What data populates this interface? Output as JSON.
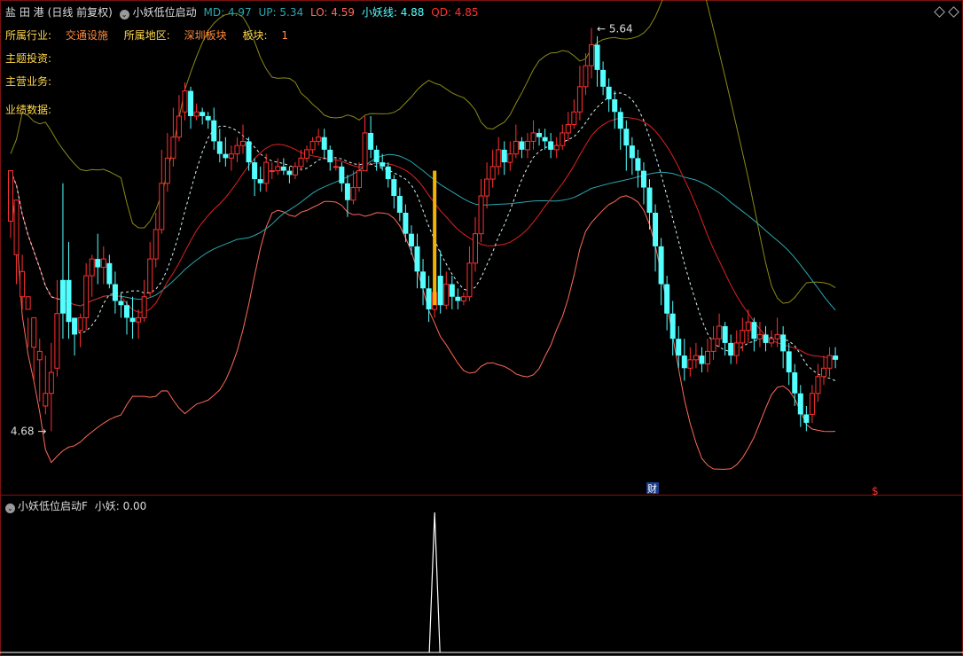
{
  "header": {
    "stock_name": "盐 田 港",
    "period": "(日线 前复权)",
    "indicator": "小妖低位启动",
    "md": "MD: 4.97",
    "up": "UP: 5.34",
    "lo": "LO: 4.59",
    "xy": "小妖线: 4.88",
    "qd": "QD: 4.85"
  },
  "info": {
    "industry_label": "所属行业:",
    "industry_value": "交通设施",
    "region_label": "所属地区:",
    "region_value": "深圳板块",
    "sector_label": "板块:",
    "sector_value": "1",
    "theme_label": "主题投资:",
    "business_label": "主营业务:",
    "performance_label": "业绩数据:"
  },
  "annotations": {
    "high_label": "5.64",
    "low_label": "4.68",
    "finance_marker": "财",
    "dollar_marker": "$"
  },
  "sub": {
    "title": "小妖低位启动F",
    "value": "小妖: 0.00"
  },
  "colors": {
    "up": "#ff3030",
    "down": "#54ffff",
    "md": "#e02020",
    "upper": "#8a8a1a",
    "lower": "#ff6a5a",
    "mid": "#2aa7b0",
    "xy": "#dcf4f4"
  },
  "chart_data": {
    "type": "candlestick",
    "price_range": [
      4.55,
      5.66
    ],
    "candles": [
      [
        5.18,
        5.3,
        5.21,
        5.14
      ],
      [
        5.1,
        5.23,
        5.13,
        5.03
      ],
      [
        5.0,
        5.06,
        5.1,
        4.97
      ],
      [
        4.97,
        5.0,
        4.95,
        4.88
      ],
      [
        4.88,
        4.95,
        4.94,
        4.8
      ],
      [
        4.85,
        4.87,
        4.9,
        4.75
      ],
      [
        4.74,
        4.77,
        4.86,
        4.72
      ],
      [
        4.77,
        4.82,
        4.89,
        4.68
      ],
      [
        4.83,
        4.96,
        5.04,
        4.81
      ],
      [
        5.04,
        4.96,
        5.27,
        4.9
      ],
      [
        5.04,
        4.94,
        5.13,
        4.9
      ],
      [
        4.95,
        4.91,
        4.95,
        4.86
      ],
      [
        4.92,
        4.95,
        4.96,
        4.88
      ],
      [
        4.95,
        5.05,
        5.08,
        4.92
      ],
      [
        5.05,
        5.09,
        5.1,
        5.0
      ],
      [
        5.09,
        5.07,
        5.15,
        5.03
      ],
      [
        5.07,
        5.09,
        5.12,
        5.03
      ],
      [
        5.08,
        5.03,
        5.1,
        5.02
      ],
      [
        5.03,
        4.99,
        5.06,
        4.96
      ],
      [
        4.99,
        4.98,
        5.01,
        4.95
      ],
      [
        4.98,
        4.95,
        4.99,
        4.91
      ],
      [
        4.95,
        4.94,
        5.0,
        4.9
      ],
      [
        4.94,
        4.95,
        4.97,
        4.9
      ],
      [
        4.95,
        5.0,
        5.04,
        4.94
      ],
      [
        5.01,
        5.09,
        5.13,
        5.0
      ],
      [
        5.09,
        5.16,
        5.2,
        5.07
      ],
      [
        5.16,
        5.27,
        5.35,
        5.15
      ],
      [
        5.27,
        5.33,
        5.39,
        5.25
      ],
      [
        5.33,
        5.38,
        5.45,
        5.31
      ],
      [
        5.38,
        5.43,
        5.48,
        5.37
      ],
      [
        5.44,
        5.49,
        5.51,
        5.42
      ],
      [
        5.49,
        5.43,
        5.5,
        5.4
      ],
      [
        5.43,
        5.44,
        5.46,
        5.42
      ],
      [
        5.44,
        5.43,
        5.45,
        5.41
      ],
      [
        5.43,
        5.42,
        5.44,
        5.4
      ],
      [
        5.42,
        5.37,
        5.45,
        5.35
      ],
      [
        5.37,
        5.34,
        5.4,
        5.32
      ],
      [
        5.34,
        5.33,
        5.38,
        5.31
      ],
      [
        5.33,
        5.34,
        5.36,
        5.3
      ],
      [
        5.34,
        5.36,
        5.38,
        5.32
      ],
      [
        5.36,
        5.37,
        5.41,
        5.34
      ],
      [
        5.37,
        5.32,
        5.38,
        5.3
      ],
      [
        5.32,
        5.28,
        5.33,
        5.24
      ],
      [
        5.28,
        5.27,
        5.31,
        5.25
      ],
      [
        5.27,
        5.32,
        5.34,
        5.25
      ],
      [
        5.3,
        5.3,
        5.32,
        5.28
      ],
      [
        5.3,
        5.31,
        5.33,
        5.29
      ],
      [
        5.31,
        5.3,
        5.33,
        5.29
      ],
      [
        5.3,
        5.29,
        5.31,
        5.27
      ],
      [
        5.29,
        5.31,
        5.32,
        5.28
      ],
      [
        5.31,
        5.33,
        5.35,
        5.3
      ],
      [
        5.33,
        5.35,
        5.36,
        5.32
      ],
      [
        5.35,
        5.37,
        5.38,
        5.34
      ],
      [
        5.37,
        5.38,
        5.4,
        5.36
      ],
      [
        5.38,
        5.35,
        5.4,
        5.33
      ],
      [
        5.35,
        5.32,
        5.36,
        5.3
      ],
      [
        5.31,
        5.31,
        5.33,
        5.3
      ],
      [
        5.31,
        5.27,
        5.32,
        5.25
      ],
      [
        5.27,
        5.23,
        5.29,
        5.19
      ],
      [
        5.23,
        5.26,
        5.3,
        5.22
      ],
      [
        5.26,
        5.3,
        5.32,
        5.25
      ],
      [
        5.3,
        5.39,
        5.43,
        5.3
      ],
      [
        5.39,
        5.35,
        5.43,
        5.33
      ],
      [
        5.35,
        5.32,
        5.36,
        5.3
      ],
      [
        5.32,
        5.31,
        5.34,
        5.3
      ],
      [
        5.31,
        5.28,
        5.32,
        5.26
      ],
      [
        5.28,
        5.24,
        5.29,
        5.21
      ],
      [
        5.24,
        5.2,
        5.26,
        5.18
      ],
      [
        5.2,
        5.15,
        5.22,
        5.13
      ],
      [
        5.15,
        5.12,
        5.17,
        5.1
      ],
      [
        5.12,
        5.06,
        5.15,
        5.02
      ],
      [
        5.06,
        5.02,
        5.09,
        4.98
      ],
      [
        5.02,
        4.97,
        5.05,
        4.94
      ],
      [
        4.97,
        5.01,
        5.04,
        4.95
      ],
      [
        5.05,
        4.98,
        5.11,
        4.96
      ],
      [
        4.98,
        5.03,
        5.06,
        4.97
      ],
      [
        5.03,
        5.0,
        5.05,
        4.97
      ],
      [
        5.0,
        4.99,
        5.02,
        4.97
      ],
      [
        4.99,
        5.0,
        5.01,
        4.98
      ],
      [
        5.0,
        5.08,
        5.12,
        4.99
      ],
      [
        5.08,
        5.15,
        5.19,
        5.06
      ],
      [
        5.15,
        5.24,
        5.28,
        5.13
      ],
      [
        5.24,
        5.28,
        5.32,
        5.21
      ],
      [
        5.28,
        5.31,
        5.35,
        5.26
      ],
      [
        5.31,
        5.35,
        5.38,
        5.29
      ],
      [
        5.35,
        5.32,
        5.37,
        5.29
      ],
      [
        5.32,
        5.34,
        5.37,
        5.3
      ],
      [
        5.34,
        5.37,
        5.41,
        5.33
      ],
      [
        5.37,
        5.35,
        5.38,
        5.33
      ],
      [
        5.35,
        5.37,
        5.39,
        5.33
      ],
      [
        5.37,
        5.39,
        5.42,
        5.35
      ],
      [
        5.39,
        5.38,
        5.4,
        5.36
      ],
      [
        5.38,
        5.37,
        5.4,
        5.35
      ],
      [
        5.37,
        5.35,
        5.39,
        5.33
      ],
      [
        5.35,
        5.36,
        5.38,
        5.33
      ],
      [
        5.36,
        5.39,
        5.41,
        5.35
      ],
      [
        5.39,
        5.41,
        5.44,
        5.37
      ],
      [
        5.41,
        5.44,
        5.47,
        5.4
      ],
      [
        5.44,
        5.5,
        5.55,
        5.42
      ],
      [
        5.5,
        5.55,
        5.58,
        5.48
      ],
      [
        5.55,
        5.6,
        5.64,
        5.52
      ],
      [
        5.6,
        5.54,
        5.62,
        5.5
      ],
      [
        5.54,
        5.5,
        5.56,
        5.48
      ],
      [
        5.5,
        5.47,
        5.52,
        5.44
      ],
      [
        5.47,
        5.44,
        5.49,
        5.4
      ],
      [
        5.44,
        5.4,
        5.45,
        5.35
      ],
      [
        5.4,
        5.36,
        5.42,
        5.3
      ],
      [
        5.36,
        5.33,
        5.38,
        5.29
      ],
      [
        5.33,
        5.3,
        5.35,
        5.26
      ],
      [
        5.3,
        5.26,
        5.32,
        5.22
      ],
      [
        5.26,
        5.2,
        5.28,
        5.16
      ],
      [
        5.2,
        5.12,
        5.22,
        5.06
      ],
      [
        5.12,
        5.03,
        5.14,
        4.98
      ],
      [
        5.03,
        4.96,
        5.05,
        4.92
      ],
      [
        4.96,
        4.9,
        4.99,
        4.86
      ],
      [
        4.9,
        4.86,
        4.93,
        4.83
      ],
      [
        4.86,
        4.83,
        4.9,
        4.8
      ],
      [
        4.83,
        4.85,
        4.88,
        4.81
      ],
      [
        4.85,
        4.86,
        4.89,
        4.83
      ],
      [
        4.86,
        4.84,
        4.88,
        4.82
      ],
      [
        4.84,
        4.87,
        4.9,
        4.82
      ],
      [
        4.87,
        4.9,
        4.93,
        4.85
      ],
      [
        4.9,
        4.93,
        4.96,
        4.88
      ],
      [
        4.93,
        4.89,
        4.94,
        4.86
      ],
      [
        4.89,
        4.86,
        4.91,
        4.84
      ],
      [
        4.86,
        4.89,
        4.92,
        4.84
      ],
      [
        4.89,
        4.92,
        4.95,
        4.87
      ],
      [
        4.92,
        4.94,
        4.97,
        4.89
      ],
      [
        4.94,
        4.9,
        4.95,
        4.87
      ],
      [
        4.9,
        4.91,
        4.94,
        4.88
      ],
      [
        4.91,
        4.89,
        4.93,
        4.87
      ],
      [
        4.89,
        4.9,
        4.92,
        4.88
      ],
      [
        4.9,
        4.91,
        4.95,
        4.88
      ],
      [
        4.91,
        4.87,
        4.93,
        4.83
      ],
      [
        4.87,
        4.82,
        4.89,
        4.79
      ],
      [
        4.82,
        4.77,
        4.84,
        4.74
      ],
      [
        4.77,
        4.72,
        4.79,
        4.69
      ],
      [
        4.72,
        4.7,
        4.74,
        4.68
      ],
      [
        4.72,
        4.77,
        4.79,
        4.7
      ],
      [
        4.77,
        4.81,
        4.84,
        4.75
      ],
      [
        4.81,
        4.83,
        4.86,
        4.79
      ],
      [
        4.83,
        4.86,
        4.88,
        4.81
      ],
      [
        4.86,
        4.85,
        4.88,
        4.83
      ]
    ]
  }
}
